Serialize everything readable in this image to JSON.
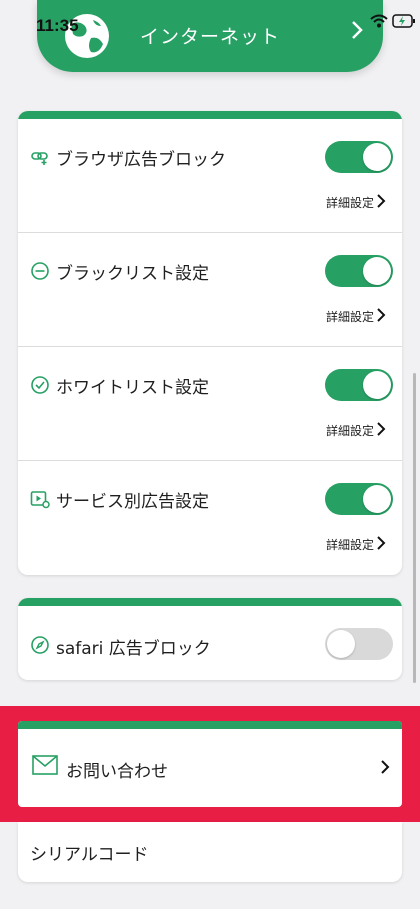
{
  "status": {
    "time": "11:35"
  },
  "header": {
    "title": "インターネット"
  },
  "features": [
    {
      "label": "ブラウザ広告ブロック",
      "icon": "link-plus-icon",
      "enabled": true,
      "detail": "詳細設定"
    },
    {
      "label": "ブラックリスト設定",
      "icon": "minus-circle-icon",
      "enabled": true,
      "detail": "詳細設定"
    },
    {
      "label": "ホワイトリスト設定",
      "icon": "check-circle-icon",
      "enabled": true,
      "detail": "詳細設定"
    },
    {
      "label": "サービス別広告設定",
      "icon": "video-gear-icon",
      "enabled": true,
      "detail": "詳細設定"
    }
  ],
  "safari": {
    "label": "safari 広告ブロック",
    "icon": "compass-icon",
    "enabled": false
  },
  "contact": {
    "label": "お問い合わせ",
    "icon": "mail-icon"
  },
  "serial": {
    "label": "シリアルコード"
  },
  "colors": {
    "accent": "#27a064",
    "highlight": "#e81e45"
  }
}
